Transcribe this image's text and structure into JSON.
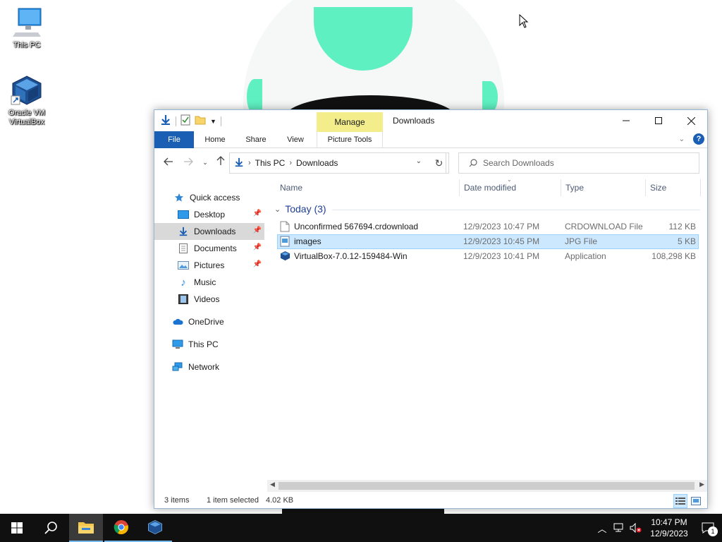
{
  "desktop": {
    "icons": [
      {
        "label": "This PC"
      },
      {
        "label": "Oracle VM VirtualBox"
      }
    ]
  },
  "window": {
    "title": "Downloads",
    "contextual_tab_group": "Manage",
    "ribbon_tabs": [
      "File",
      "Home",
      "Share",
      "View",
      "Picture Tools"
    ],
    "address": {
      "crumbs": [
        "This PC",
        "Downloads"
      ]
    },
    "search": {
      "placeholder": "Search Downloads"
    },
    "nav_pane": {
      "quick_access": "Quick access",
      "items": [
        {
          "label": "Desktop",
          "pinned": true
        },
        {
          "label": "Downloads",
          "pinned": true,
          "selected": true
        },
        {
          "label": "Documents",
          "pinned": true
        },
        {
          "label": "Pictures",
          "pinned": true
        },
        {
          "label": "Music",
          "pinned": false
        },
        {
          "label": "Videos",
          "pinned": false
        }
      ],
      "onedrive": "OneDrive",
      "this_pc": "This PC",
      "network": "Network"
    },
    "columns": [
      "Name",
      "Date modified",
      "Type",
      "Size"
    ],
    "group": "Today (3)",
    "files": [
      {
        "name": "Unconfirmed 567694.crdownload",
        "date": "12/9/2023 10:47 PM",
        "type": "CRDOWNLOAD File",
        "size": "112 KB"
      },
      {
        "name": "images",
        "date": "12/9/2023 10:45 PM",
        "type": "JPG File",
        "size": "5 KB",
        "selected": true
      },
      {
        "name": "VirtualBox-7.0.12-159484-Win",
        "date": "12/9/2023 10:41 PM",
        "type": "Application",
        "size": "108,298 KB"
      }
    ],
    "status": {
      "item_count": "3 items",
      "selection": "1 item selected",
      "selection_size": "4.02 KB"
    }
  },
  "taskbar": {
    "clock_time": "10:47 PM",
    "clock_date": "12/9/2023",
    "notification_count": "1"
  },
  "colors": {
    "accent": "#1a5fb4",
    "manage_tab": "#f3ee8b",
    "selection": "#cce8ff",
    "wallpaper_green": "#5ef0c0",
    "taskbar": "#101010"
  }
}
